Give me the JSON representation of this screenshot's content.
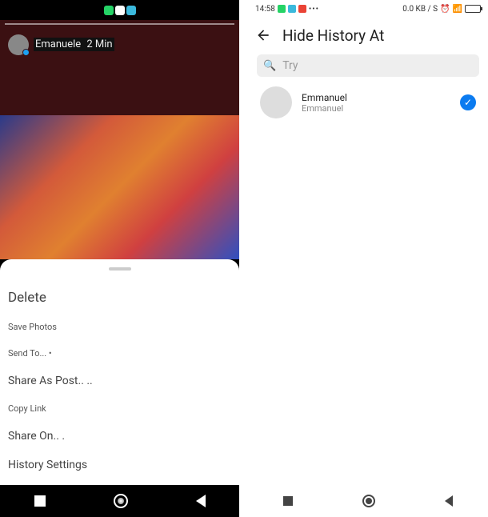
{
  "left": {
    "story": {
      "user": "Emanuele",
      "time": "2 Min"
    },
    "sheet": {
      "delete": "Delete",
      "save": "Save Photos",
      "send": "Send To... •",
      "share_post": "Share As Post.. ..",
      "copy_link": "Copy Link",
      "share_on": "Share On.. .",
      "history": "History Settings"
    }
  },
  "right": {
    "statusbar": {
      "time": "14:58",
      "data": "0.0 KB / S"
    },
    "header": {
      "title": "Hide History At"
    },
    "search": {
      "placeholder": "Try"
    },
    "contact": {
      "name": "Emmanuel",
      "sub": "Emmanuel"
    }
  }
}
